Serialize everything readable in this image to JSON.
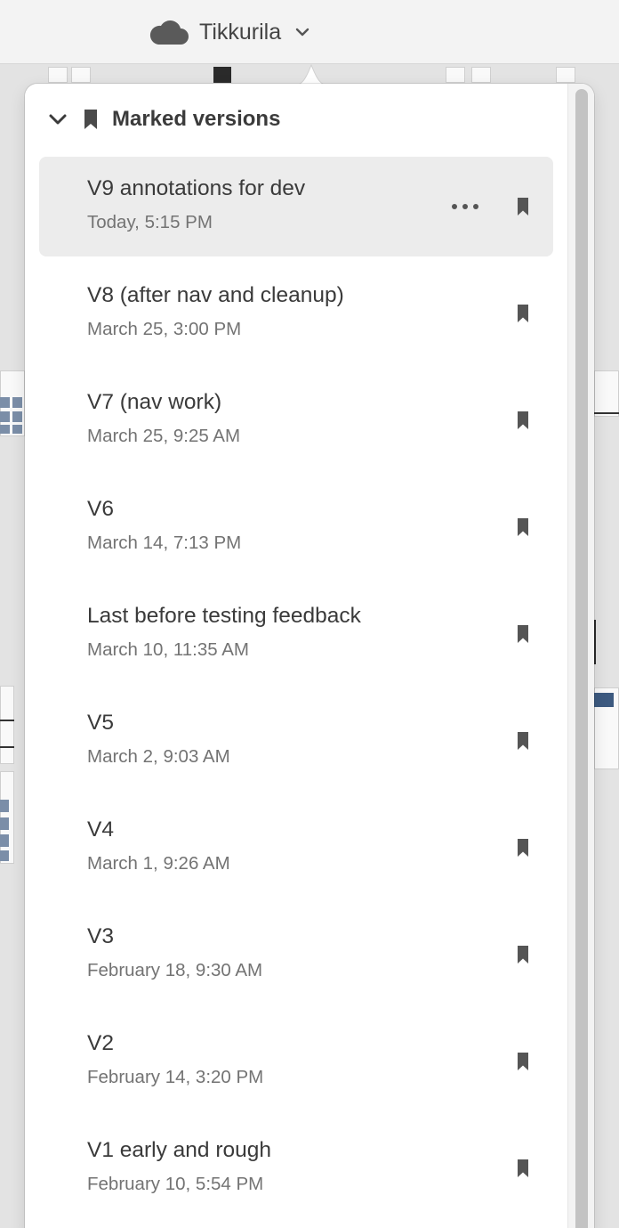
{
  "titlebar": {
    "doc_name": "Tikkurila",
    "icon": "cloud-icon",
    "dropdown_icon": "chevron-down-icon"
  },
  "panel": {
    "section_title": "Marked versions",
    "section_icon": "bookmark-icon",
    "collapse_icon": "chevron-down-icon"
  },
  "versions": [
    {
      "name": "V9 annotations for dev",
      "date": "Today, 5:15 PM",
      "selected": true
    },
    {
      "name": "V8 (after nav and cleanup)",
      "date": "March 25, 3:00 PM"
    },
    {
      "name": "V7 (nav work)",
      "date": "March 25, 9:25 AM"
    },
    {
      "name": "V6",
      "date": "March 14, 7:13 PM"
    },
    {
      "name": "Last before testing feedback",
      "date": "March 10, 11:35 AM"
    },
    {
      "name": "V5",
      "date": "March 2, 9:03 AM"
    },
    {
      "name": "V4",
      "date": "March 1, 9:26 AM"
    },
    {
      "name": "V3",
      "date": "February 18, 9:30 AM"
    },
    {
      "name": "V2",
      "date": "February 14, 3:20 PM"
    },
    {
      "name": "V1 early and rough",
      "date": "February 10, 5:54 PM"
    }
  ],
  "colors": {
    "selected_row": "#ececec",
    "icon": "#555555",
    "date_text": "#737373"
  }
}
